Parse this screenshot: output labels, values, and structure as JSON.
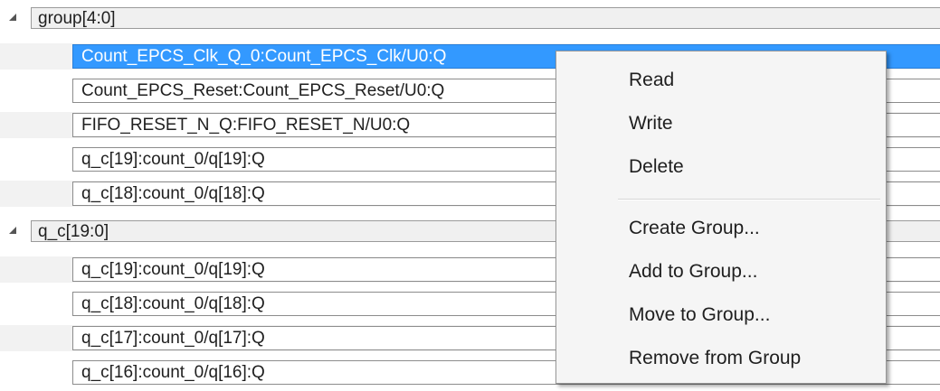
{
  "tree": {
    "group1": {
      "label": "group[4:0]",
      "items": [
        "Count_EPCS_Clk_Q_0:Count_EPCS_Clk/U0:Q",
        "Count_EPCS_Reset:Count_EPCS_Reset/U0:Q",
        "FIFO_RESET_N_Q:FIFO_RESET_N/U0:Q",
        "q_c[19]:count_0/q[19]:Q",
        "q_c[18]:count_0/q[18]:Q"
      ]
    },
    "group2": {
      "label": "q_c[19:0]",
      "items": [
        "q_c[19]:count_0/q[19]:Q",
        "q_c[18]:count_0/q[18]:Q",
        "q_c[17]:count_0/q[17]:Q",
        "q_c[16]:count_0/q[16]:Q"
      ]
    }
  },
  "context_menu": {
    "items": [
      "Read",
      "Write",
      "Delete",
      "Create Group...",
      "Add to Group...",
      "Move to Group...",
      "Remove from Group"
    ]
  },
  "colors": {
    "selection": "#3399ff",
    "row_alt": "#f2f2f2",
    "menu_bg": "#f5f5f5"
  }
}
